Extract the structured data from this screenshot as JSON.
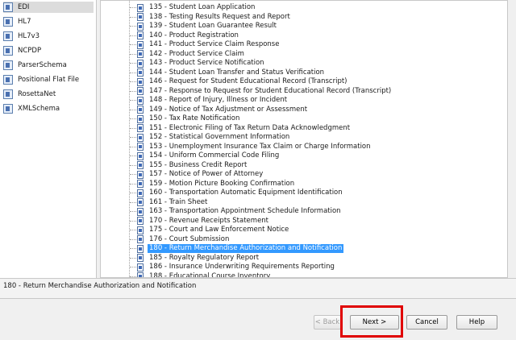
{
  "left_panel": {
    "items": [
      {
        "label": "EDI",
        "selected": true
      },
      {
        "label": "HL7",
        "selected": false
      },
      {
        "label": "HL7v3",
        "selected": false
      },
      {
        "label": "NCPDP",
        "selected": false
      },
      {
        "label": "ParserSchema",
        "selected": false
      },
      {
        "label": "Positional Flat File",
        "selected": false
      },
      {
        "label": "RosettaNet",
        "selected": false
      },
      {
        "label": "XMLSchema",
        "selected": false
      }
    ]
  },
  "tree": {
    "rows": [
      {
        "label": "135 - Student Loan Application"
      },
      {
        "label": "138 - Testing Results Request and Report"
      },
      {
        "label": "139 - Student Loan Guarantee Result"
      },
      {
        "label": "140 - Product Registration"
      },
      {
        "label": "141 - Product Service Claim Response"
      },
      {
        "label": "142 - Product Service Claim"
      },
      {
        "label": "143 - Product Service Notification"
      },
      {
        "label": "144 - Student Loan Transfer and Status Verification"
      },
      {
        "label": "146 - Request for Student Educational Record (Transcript)"
      },
      {
        "label": "147 - Response to Request for Student Educational Record (Transcript)"
      },
      {
        "label": "148 - Report of Injury, Illness or Incident"
      },
      {
        "label": "149 - Notice of Tax Adjustment or Assessment"
      },
      {
        "label": "150 - Tax Rate Notification"
      },
      {
        "label": "151 - Electronic Filing of Tax Return Data Acknowledgment"
      },
      {
        "label": "152 - Statistical Government Information"
      },
      {
        "label": "153 - Unemployment Insurance Tax Claim or Charge Information"
      },
      {
        "label": "154 - Uniform Commercial Code Filing"
      },
      {
        "label": "155 - Business Credit Report"
      },
      {
        "label": "157 - Notice of Power of Attorney"
      },
      {
        "label": "159 - Motion Picture Booking Confirmation"
      },
      {
        "label": "160 - Transportation Automatic Equipment Identification"
      },
      {
        "label": "161 - Train Sheet"
      },
      {
        "label": "163 - Transportation Appointment Schedule Information"
      },
      {
        "label": "170 - Revenue Receipts Statement"
      },
      {
        "label": "175 - Court and Law Enforcement Notice"
      },
      {
        "label": "176 - Court Submission"
      },
      {
        "label": "180 - Return Merchandise Authorization and Notification",
        "selected": true
      },
      {
        "label": "185 - Royalty Regulatory Report"
      },
      {
        "label": "186 - Insurance Underwriting Requirements Reporting"
      },
      {
        "label": "188 - Educational Course Inventory"
      }
    ]
  },
  "description": "180 - Return Merchandise Authorization and Notification",
  "buttons": {
    "back": "< Back",
    "next": "Next >",
    "cancel": "Cancel",
    "help": "Help"
  },
  "colors": {
    "selection": "#3399ff",
    "highlight_box": "#e00000"
  }
}
